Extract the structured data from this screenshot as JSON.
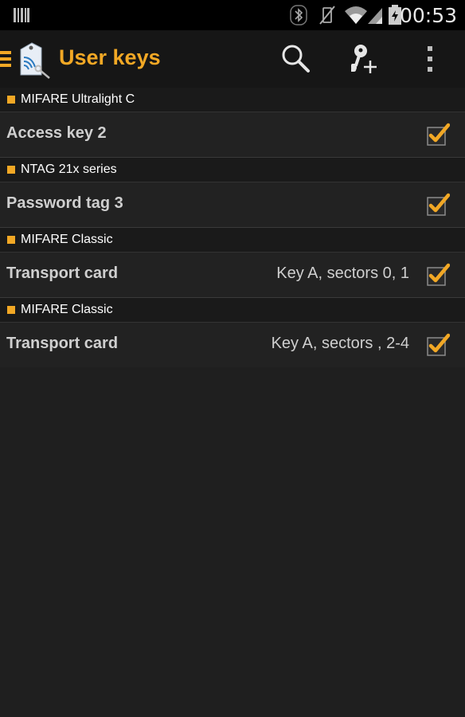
{
  "status_bar": {
    "time": "00:53",
    "icons": [
      "barcode-icon",
      "bluetooth-icon",
      "vibrate-icon",
      "wifi-icon",
      "signal-icon",
      "battery-icon"
    ]
  },
  "action_bar": {
    "title": "User keys",
    "accent_color": "#f2a825",
    "actions": [
      "search-icon",
      "add-key-icon",
      "overflow-menu-icon"
    ]
  },
  "list": {
    "sections": [
      {
        "header": "MIFARE Ultralight C",
        "item": {
          "title": "Access key 2",
          "detail": "",
          "checked": true
        }
      },
      {
        "header": "NTAG 21x series",
        "item": {
          "title": "Password tag 3",
          "detail": "",
          "checked": true
        }
      },
      {
        "header": "MIFARE Classic",
        "item": {
          "title": "Transport card",
          "detail": "Key A, sectors 0, 1",
          "checked": true
        }
      },
      {
        "header": "MIFARE Classic",
        "item": {
          "title": "Transport card",
          "detail": "Key A, sectors , 2-4",
          "checked": true
        }
      }
    ]
  }
}
